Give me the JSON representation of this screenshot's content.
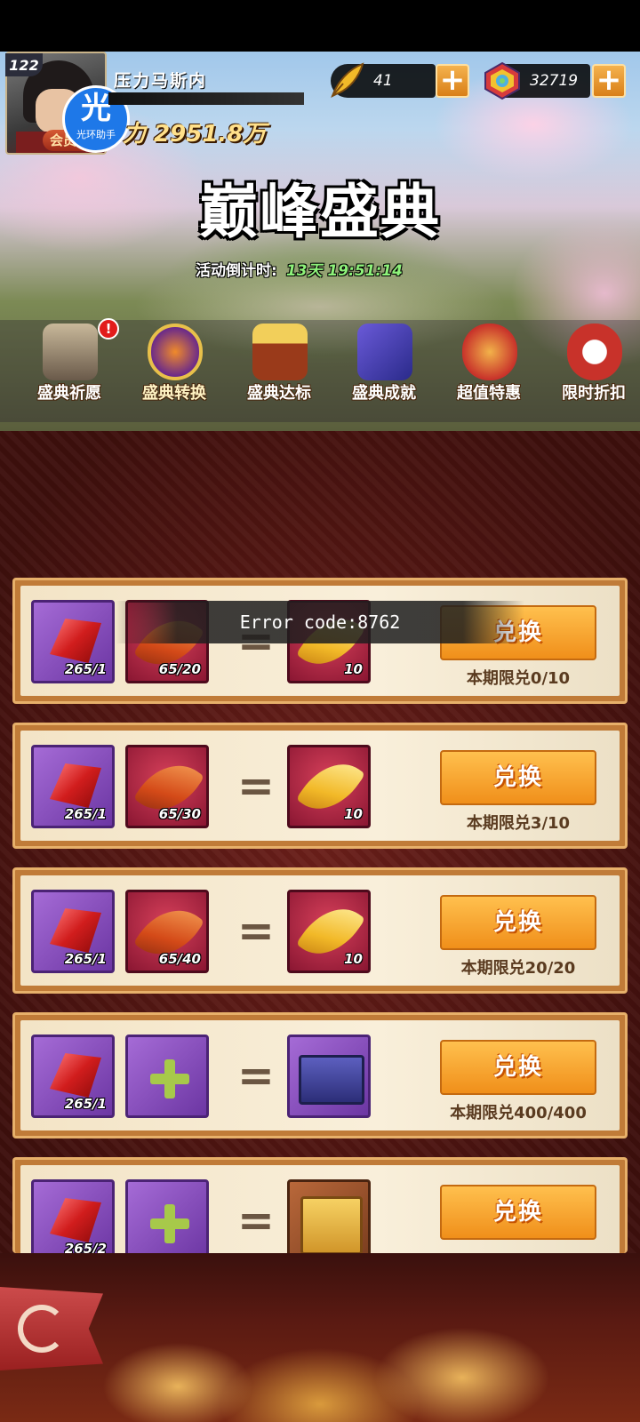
{
  "player": {
    "level": "122",
    "name": "压力马斯内",
    "power": "力 2951.8万",
    "vip_label": "会员"
  },
  "helper": {
    "glyph": "光",
    "label": "光环助手"
  },
  "currencies": [
    {
      "icon": "gold-feather-icon",
      "value": "41"
    },
    {
      "icon": "rainbow-gem-icon",
      "value": "32719"
    }
  ],
  "event": {
    "title": "巅峰盛典",
    "countdown_label": "活动倒计时:",
    "countdown_value": "13天 19:51:14"
  },
  "tabs": [
    {
      "label": "盛典祈愿",
      "icon": "shrine-icon",
      "badge": "!"
    },
    {
      "label": "盛典转换",
      "icon": "orb-icon",
      "active": true
    },
    {
      "label": "盛典达标",
      "icon": "treasure-chest-icon"
    },
    {
      "label": "盛典成就",
      "icon": "gift-box-icon"
    },
    {
      "label": "超值特惠",
      "icon": "money-bag-icon"
    },
    {
      "label": "限时折扣",
      "icon": "clock-icon"
    }
  ],
  "exchange_button_label": "兑换",
  "exchanges": [
    {
      "cost1_qty": "265/1",
      "cost2_type": "red-feather",
      "cost2_qty": "65/20",
      "reward_type": "gold-feather",
      "reward_qty": "10",
      "limit": "本期限兑0/10"
    },
    {
      "cost1_qty": "265/1",
      "cost2_type": "red-feather",
      "cost2_qty": "65/30",
      "reward_type": "gold-feather",
      "reward_qty": "10",
      "limit": "本期限兑3/10"
    },
    {
      "cost1_qty": "265/1",
      "cost2_type": "red-feather",
      "cost2_qty": "65/40",
      "reward_type": "gold-feather",
      "reward_qty": "10",
      "limit": "本期限兑20/20"
    },
    {
      "cost1_qty": "265/1",
      "cost2_type": "plus",
      "cost2_qty": "",
      "reward_type": "blue-box",
      "reward_qty": "",
      "limit": "本期限兑400/400"
    },
    {
      "cost1_qty": "265/2",
      "cost2_type": "plus",
      "cost2_qty": "",
      "reward_type": "gold-box",
      "reward_qty": "",
      "limit": ""
    }
  ],
  "error_message": "Error code:8762",
  "colors": {
    "accent": "#f08f1a",
    "background": "#4a1512",
    "card": "#f3e4c6"
  }
}
